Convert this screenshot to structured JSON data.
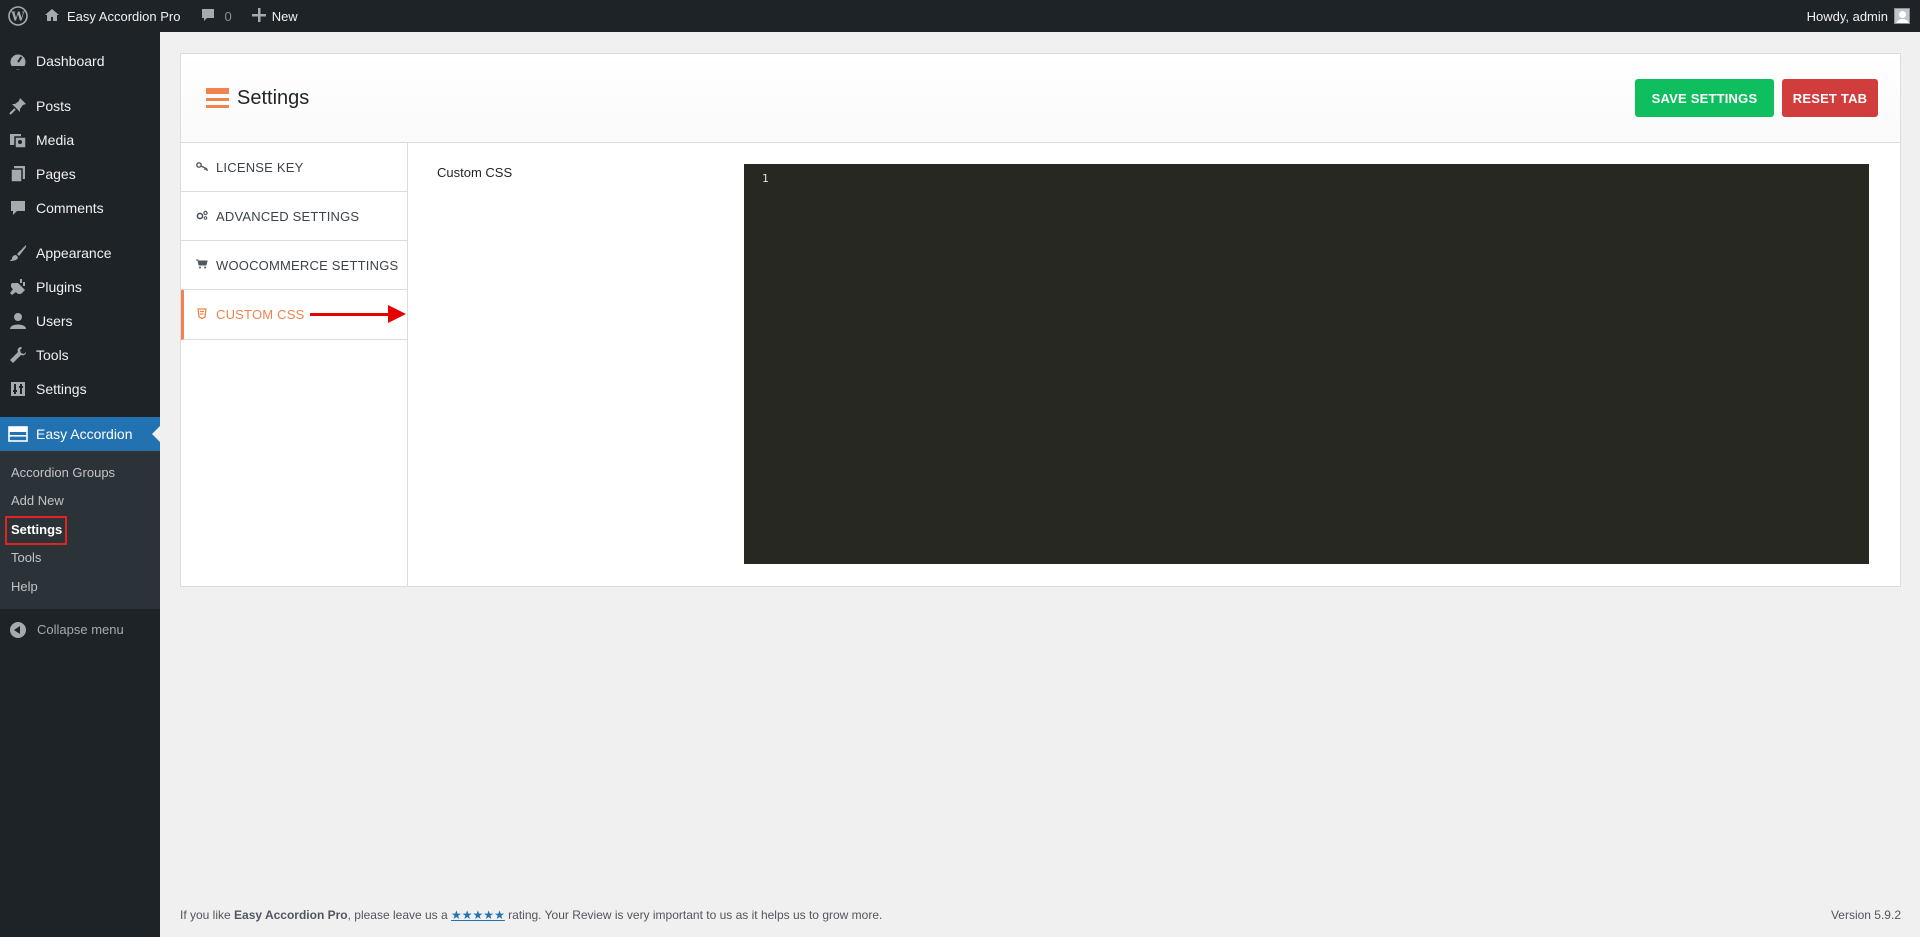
{
  "adminbar": {
    "site_name": "Easy Accordion Pro",
    "comments_count": "0",
    "new_label": "New",
    "howdy": "Howdy, admin"
  },
  "sidebar": {
    "items": [
      {
        "label": "Dashboard",
        "icon": "dashboard-icon"
      },
      {
        "label": "Posts",
        "icon": "pin-icon"
      },
      {
        "label": "Media",
        "icon": "media-icon"
      },
      {
        "label": "Pages",
        "icon": "pages-icon"
      },
      {
        "label": "Comments",
        "icon": "comment-icon"
      },
      {
        "label": "Appearance",
        "icon": "brush-icon"
      },
      {
        "label": "Plugins",
        "icon": "plug-icon"
      },
      {
        "label": "Users",
        "icon": "user-icon"
      },
      {
        "label": "Tools",
        "icon": "wrench-icon"
      },
      {
        "label": "Settings",
        "icon": "settings-icon"
      },
      {
        "label": "Easy Accordion",
        "icon": "accordion-icon"
      }
    ],
    "submenu": [
      "Accordion Groups",
      "Add New",
      "Settings",
      "Tools",
      "Help"
    ],
    "collapse": "Collapse menu"
  },
  "panel": {
    "title": "Settings",
    "save_label": "SAVE SETTINGS",
    "reset_label": "RESET TAB",
    "tabs": [
      "LICENSE KEY",
      "ADVANCED SETTINGS",
      "WOOCOMMERCE SETTINGS",
      "CUSTOM CSS"
    ],
    "field_label": "Custom CSS",
    "line_number": "1"
  },
  "footer": {
    "pre": "If you like ",
    "plugin": "Easy Accordion Pro",
    "mid": ", please leave us a ",
    "stars": "★★★★★",
    "post": " rating. Your Review is very important to us as it helps us to grow more.",
    "version": "Version 5.9.2"
  },
  "colors": {
    "accent": "#f0834e",
    "save": "#0fbf5f",
    "reset": "#d13c3c",
    "menu_current": "#2271b1"
  }
}
